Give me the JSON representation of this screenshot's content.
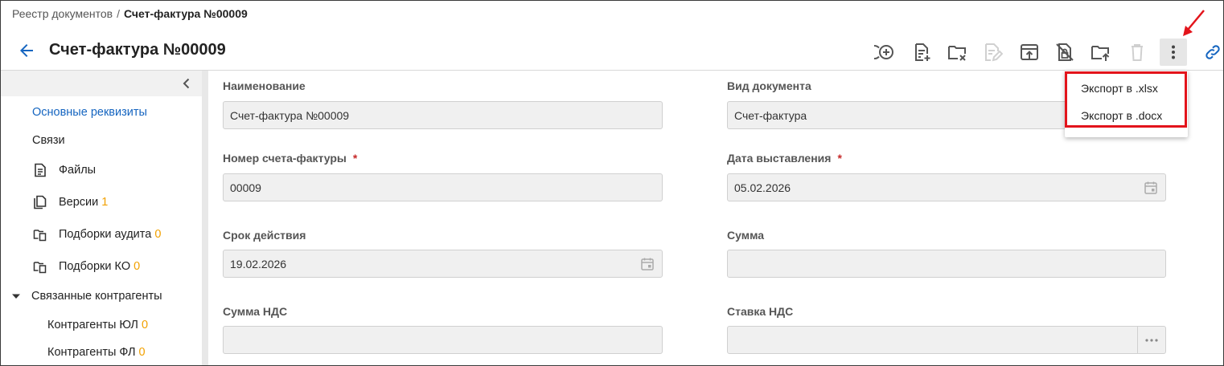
{
  "breadcrumb": {
    "parent": "Реестр документов",
    "separator": "/",
    "current": "Счет-фактура №00009"
  },
  "header": {
    "title": "Счет-фактура №00009"
  },
  "toolbar": {
    "icons": [
      "add-circle-icon",
      "document-add-icon",
      "folder-remove-icon",
      "edit-document-icon",
      "upload-icon",
      "lock-off-icon",
      "folder-upload-icon",
      "trash-icon",
      "more-vertical-icon",
      "link-icon"
    ],
    "disabled": [
      "edit-document-icon",
      "trash-icon"
    ]
  },
  "sidebar": {
    "items": [
      {
        "label": "Основные реквизиты",
        "active": true
      },
      {
        "label": "Связи"
      },
      {
        "label": "Файлы",
        "icon": "file-icon"
      },
      {
        "label": "Версии",
        "count": "1",
        "icon": "copy-icon"
      },
      {
        "label": "Подборки аудита",
        "count": "0",
        "icon": "folder-copy-icon"
      },
      {
        "label": "Подборки КО",
        "count": "0",
        "icon": "folder-copy-icon"
      },
      {
        "label": "Связанные контрагенты",
        "expanded": true
      },
      {
        "label": "Контрагенты ЮЛ",
        "count": "0"
      },
      {
        "label": "Контрагенты ФЛ",
        "count": "0"
      }
    ]
  },
  "form": {
    "name": {
      "label": "Наименование",
      "value": "Счет-фактура №00009"
    },
    "doc_type": {
      "label": "Вид документа",
      "value": "Счет-фактура"
    },
    "invoice_number": {
      "label": "Номер счета-фактуры",
      "required": "*",
      "value": "00009"
    },
    "issue_date": {
      "label": "Дата выставления",
      "required": "*",
      "value": "05.02.2026"
    },
    "validity": {
      "label": "Срок действия",
      "value": "19.02.2026"
    },
    "amount": {
      "label": "Сумма",
      "value": ""
    },
    "vat_amount": {
      "label": "Сумма НДС",
      "value": ""
    },
    "vat_rate": {
      "label": "Ставка НДС",
      "value": ""
    }
  },
  "dropdown": {
    "items": [
      "Экспорт в .xlsx",
      "Экспорт в .docx"
    ]
  },
  "colors": {
    "accent": "#1565c0",
    "count": "#f2a100",
    "required": "#c62828",
    "annotation": "#e3141b"
  }
}
